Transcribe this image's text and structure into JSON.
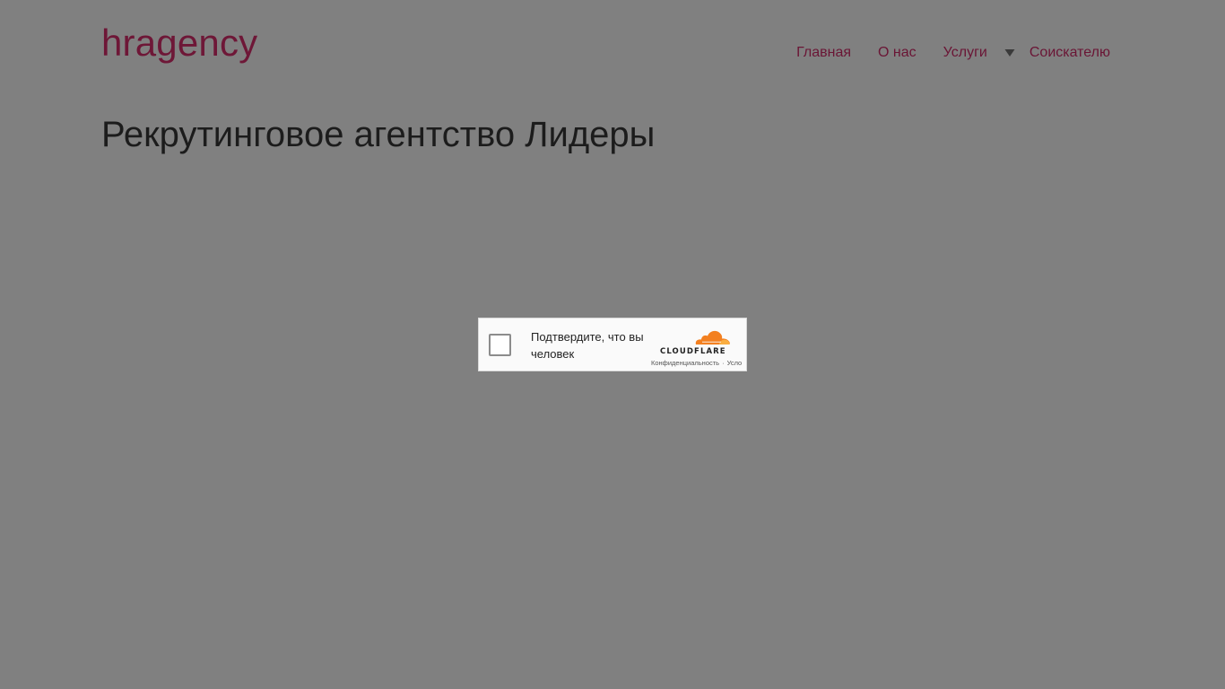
{
  "site": {
    "logo": "hragency"
  },
  "nav": {
    "items": [
      "Главная",
      "О нас",
      "Услуги",
      "Соискателю"
    ],
    "dropdown_icon": "chevron-down-icon"
  },
  "page": {
    "title": "Рекрутинговое агентство Лидеры"
  },
  "captcha": {
    "label": "Подтвердите, что вы человек",
    "brand": "CLOUDFLARE",
    "privacy_link": "Конфиденциальность",
    "terms_link": "Усло",
    "separator": "·",
    "checked": false
  },
  "colors": {
    "background": "#808080",
    "brand_text": "#6e1737",
    "cloudflare_orange": "#f38020"
  }
}
